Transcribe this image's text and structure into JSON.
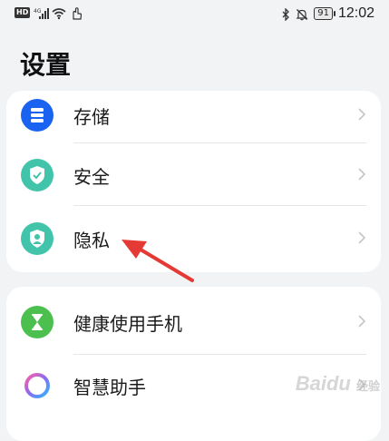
{
  "status_bar": {
    "hd_badge": "HD",
    "network_label": "4G",
    "battery_level": "91",
    "time": "12:02",
    "icons": [
      "signal-icon",
      "wifi-icon",
      "hand-icon",
      "bluetooth-icon",
      "mute-icon"
    ]
  },
  "page": {
    "title": "设置"
  },
  "cards": [
    {
      "items": [
        {
          "label": "存储",
          "icon": "storage-icon",
          "color": "#1a63f0"
        },
        {
          "label": "安全",
          "icon": "shield-check-icon",
          "color": "#41c4a9"
        },
        {
          "label": "隐私",
          "icon": "privacy-person-icon",
          "color": "#41c4a9"
        }
      ]
    },
    {
      "items": [
        {
          "label": "健康使用手机",
          "icon": "hourglass-icon",
          "color": "#4bc04f"
        },
        {
          "label": "智慧助手",
          "icon": "assistant-ring-icon",
          "color": "#8a6cf0"
        }
      ]
    }
  ],
  "annotation": {
    "color": "#e53935",
    "target": "隐私"
  },
  "watermark": {
    "text": "Baidu",
    "sub": "经验"
  }
}
